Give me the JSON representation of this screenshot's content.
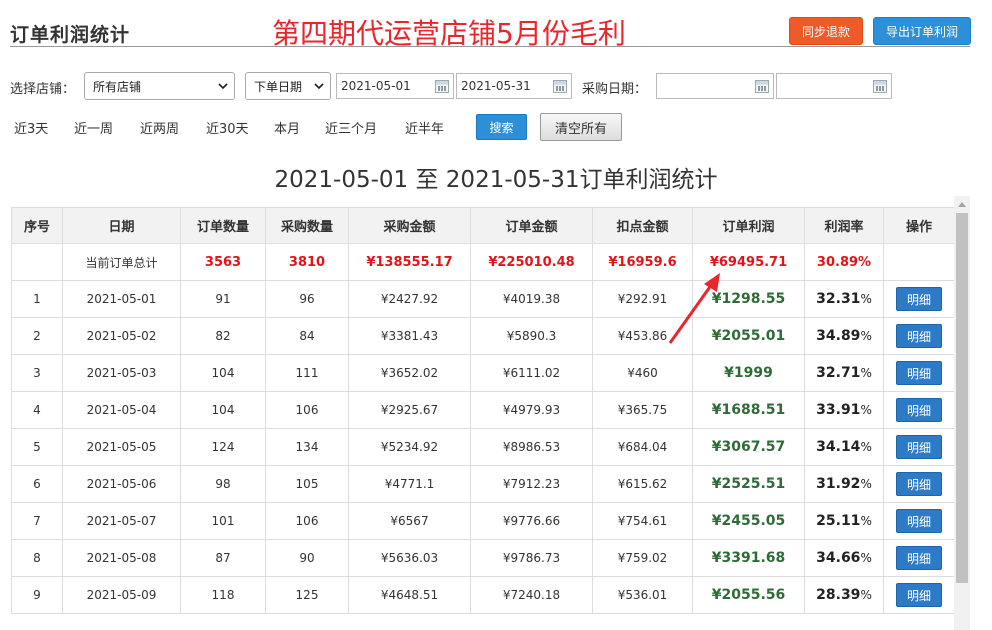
{
  "header": {
    "title": "订单利润统计",
    "overlay_title": "第四期代运营店铺5月份毛利",
    "sync_label": "同步退款",
    "export_label": "导出订单利润"
  },
  "filters": {
    "store_label": "选择店铺：",
    "store_value": "所有店铺",
    "date_type_value": "下单日期",
    "start_date": "2021-05-01",
    "end_date": "2021-05-31",
    "purchase_date_label": "采购日期：",
    "purchase_start": "",
    "purchase_end": "",
    "quick_ranges": [
      "近3天",
      "近一周",
      "近两周",
      "近30天",
      "本月",
      "近三个月",
      "近半年"
    ],
    "search_label": "搜索",
    "clear_label": "清空所有"
  },
  "report_title": "2021-05-01 至 2021-05-31订单利润统计",
  "table": {
    "columns": [
      "序号",
      "日期",
      "订单数量",
      "采购数量",
      "采购金额",
      "订单金额",
      "扣点金额",
      "订单利润",
      "利润率",
      "操作"
    ],
    "total": {
      "label": "当前订单总计",
      "orders": "3563",
      "purchases": "3810",
      "purchase_amount": "¥138555.17",
      "order_amount": "¥225010.48",
      "deduction": "¥16959.6",
      "profit": "¥69495.71",
      "rate": "30.89%"
    },
    "detail_label": "明细",
    "rows": [
      {
        "no": "1",
        "date": "2021-05-01",
        "orders": "91",
        "purchases": "96",
        "purchase_amount": "¥2427.92",
        "order_amount": "¥4019.38",
        "deduction": "¥292.91",
        "profit": "¥1298.55",
        "rate": "32.31",
        "pct": "%"
      },
      {
        "no": "2",
        "date": "2021-05-02",
        "orders": "82",
        "purchases": "84",
        "purchase_amount": "¥3381.43",
        "order_amount": "¥5890.3",
        "deduction": "¥453.86",
        "profit": "¥2055.01",
        "rate": "34.89",
        "pct": "%"
      },
      {
        "no": "3",
        "date": "2021-05-03",
        "orders": "104",
        "purchases": "111",
        "purchase_amount": "¥3652.02",
        "order_amount": "¥6111.02",
        "deduction": "¥460",
        "profit": "¥1999",
        "rate": "32.71",
        "pct": "%"
      },
      {
        "no": "4",
        "date": "2021-05-04",
        "orders": "104",
        "purchases": "106",
        "purchase_amount": "¥2925.67",
        "order_amount": "¥4979.93",
        "deduction": "¥365.75",
        "profit": "¥1688.51",
        "rate": "33.91",
        "pct": "%"
      },
      {
        "no": "5",
        "date": "2021-05-05",
        "orders": "124",
        "purchases": "134",
        "purchase_amount": "¥5234.92",
        "order_amount": "¥8986.53",
        "deduction": "¥684.04",
        "profit": "¥3067.57",
        "rate": "34.14",
        "pct": "%"
      },
      {
        "no": "6",
        "date": "2021-05-06",
        "orders": "98",
        "purchases": "105",
        "purchase_amount": "¥4771.1",
        "order_amount": "¥7912.23",
        "deduction": "¥615.62",
        "profit": "¥2525.51",
        "rate": "31.92",
        "pct": "%"
      },
      {
        "no": "7",
        "date": "2021-05-07",
        "orders": "101",
        "purchases": "106",
        "purchase_amount": "¥6567",
        "order_amount": "¥9776.66",
        "deduction": "¥754.61",
        "profit": "¥2455.05",
        "rate": "25.11",
        "pct": "%"
      },
      {
        "no": "8",
        "date": "2021-05-08",
        "orders": "87",
        "purchases": "90",
        "purchase_amount": "¥5636.03",
        "order_amount": "¥9786.73",
        "deduction": "¥759.02",
        "profit": "¥3391.68",
        "rate": "34.66",
        "pct": "%"
      },
      {
        "no": "9",
        "date": "2021-05-09",
        "orders": "118",
        "purchases": "125",
        "purchase_amount": "¥4648.51",
        "order_amount": "¥7240.18",
        "deduction": "¥536.01",
        "profit": "¥2055.56",
        "rate": "28.39",
        "pct": "%"
      }
    ]
  },
  "colors": {
    "primary_blue": "#2d8fd8",
    "orange": "#f05a28",
    "red": "#e0141a",
    "green": "#2f6b36"
  }
}
